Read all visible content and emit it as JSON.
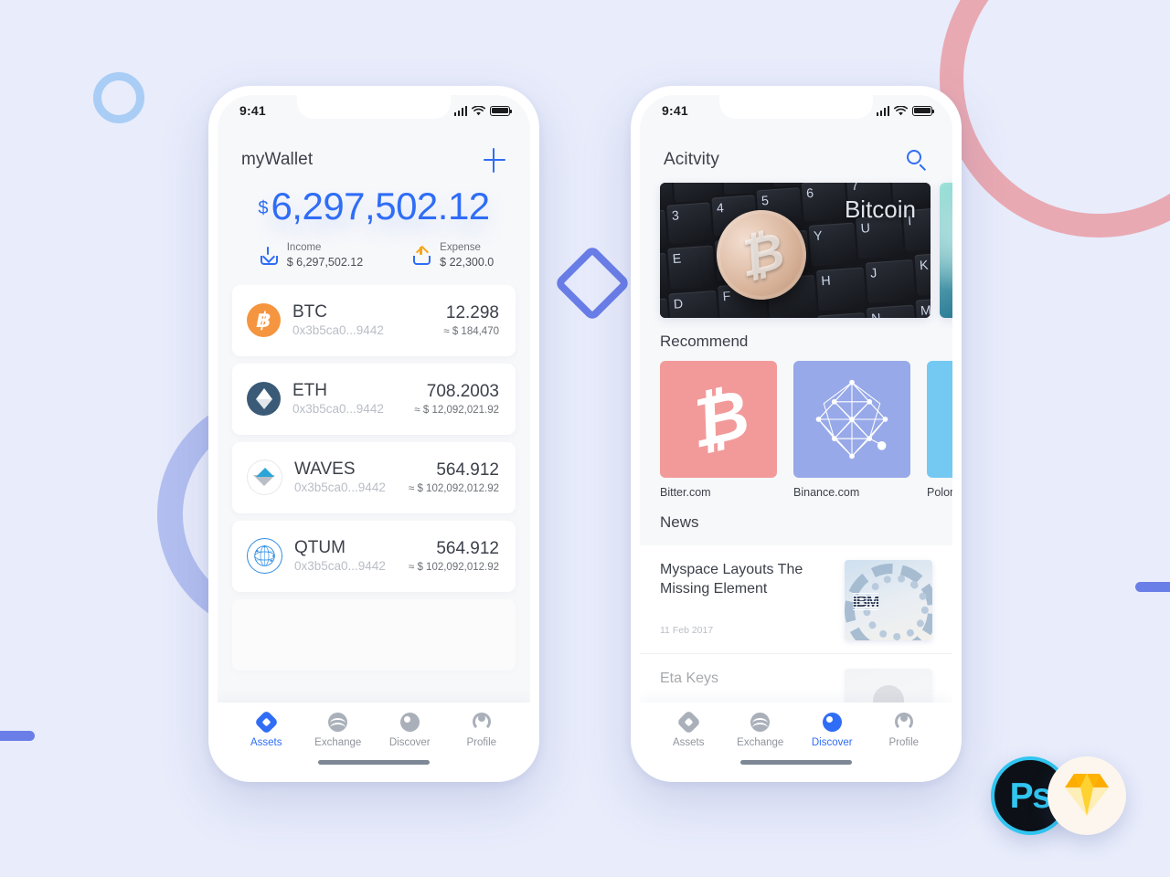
{
  "background": {
    "color": "#e8ecfb",
    "decorations": [
      {
        "name": "ring-small",
        "color": "#a9cdf5"
      },
      {
        "name": "arc-pink",
        "color": "#e9a9b2"
      },
      {
        "name": "arc-blue",
        "color": "#b3bff0"
      },
      {
        "name": "diamond",
        "color": "#6a7ee8"
      },
      {
        "name": "bar-left",
        "color": "#6a7ee8"
      },
      {
        "name": "bar-right",
        "color": "#6a7ee8"
      }
    ]
  },
  "accent": "#2f6df6",
  "phone_left": {
    "status": {
      "time": "9:41",
      "signal_icon": "cellular-signal-icon",
      "wifi_icon": "wifi-icon",
      "battery_icon": "battery-full-icon"
    },
    "header": {
      "title": "myWallet",
      "add_icon": "plus-icon"
    },
    "balance": {
      "currency": "$",
      "amount": "6,297,502.12"
    },
    "summary": [
      {
        "icon": "income-download-icon",
        "label": "Income",
        "value": "$ 6,297,502.12"
      },
      {
        "icon": "expense-upload-icon",
        "label": "Expense",
        "value": "$ 22,300.0"
      }
    ],
    "assets": [
      {
        "icon": "bitcoin-coin-icon",
        "symbol": "BTC",
        "address": "0x3b5ca0...9442",
        "amount": "12.298",
        "usd": "≈ $ 184,470"
      },
      {
        "icon": "ethereum-coin-icon",
        "symbol": "ETH",
        "address": "0x3b5ca0...9442",
        "amount": "708.2003",
        "usd": "≈ $ 12,092,021.92"
      },
      {
        "icon": "waves-coin-icon",
        "symbol": "WAVES",
        "address": "0x3b5ca0...9442",
        "amount": "564.912",
        "usd": "≈ $ 102,092,012.92"
      },
      {
        "icon": "qtum-coin-icon",
        "symbol": "QTUM",
        "address": "0x3b5ca0...9442",
        "amount": "564.912",
        "usd": "≈ $ 102,092,012.92"
      }
    ],
    "tabs": [
      {
        "icon": "assets-diamond-icon",
        "label": "Assets",
        "active": true
      },
      {
        "icon": "exchange-wave-icon",
        "label": "Exchange",
        "active": false
      },
      {
        "icon": "discover-circle-icon",
        "label": "Discover",
        "active": false
      },
      {
        "icon": "profile-person-icon",
        "label": "Profile",
        "active": false
      }
    ]
  },
  "phone_right": {
    "status": {
      "time": "9:41",
      "signal_icon": "cellular-signal-icon",
      "wifi_icon": "wifi-icon",
      "battery_icon": "battery-full-icon"
    },
    "header": {
      "title": "Acitvity",
      "search_icon": "search-icon"
    },
    "banners": [
      {
        "caption": "Bitcoin",
        "image": "bitcoin-coin-on-keyboard-photo"
      },
      {
        "caption": "",
        "image": "teal-abstract-photo"
      }
    ],
    "recommend": {
      "title": "Recommend",
      "items": [
        {
          "label": "Bitter.com",
          "icon": "bitcoin-b-icon",
          "color": "#f29a9a"
        },
        {
          "label": "Binance.com",
          "icon": "network-mesh-icon",
          "color": "#97a9e8"
        },
        {
          "label": "Polonie",
          "icon": "polo-icon",
          "color": "#74c9f2"
        }
      ]
    },
    "news": {
      "title": "News",
      "items": [
        {
          "title": "Myspace Layouts The Missing Element",
          "date": "11 Feb 2017",
          "thumb": "ibm-hardware-photo"
        },
        {
          "title": "Eta Keys",
          "date": "",
          "thumb": "person-avatar-photo"
        }
      ]
    },
    "tabs": [
      {
        "icon": "assets-diamond-icon",
        "label": "Assets",
        "active": false
      },
      {
        "icon": "exchange-wave-icon",
        "label": "Exchange",
        "active": false
      },
      {
        "icon": "discover-circle-icon",
        "label": "Discover",
        "active": true
      },
      {
        "icon": "profile-person-icon",
        "label": "Profile",
        "active": false
      }
    ]
  },
  "badges": [
    {
      "name": "photoshop-badge",
      "label": "Ps"
    },
    {
      "name": "sketch-badge",
      "label": ""
    }
  ]
}
